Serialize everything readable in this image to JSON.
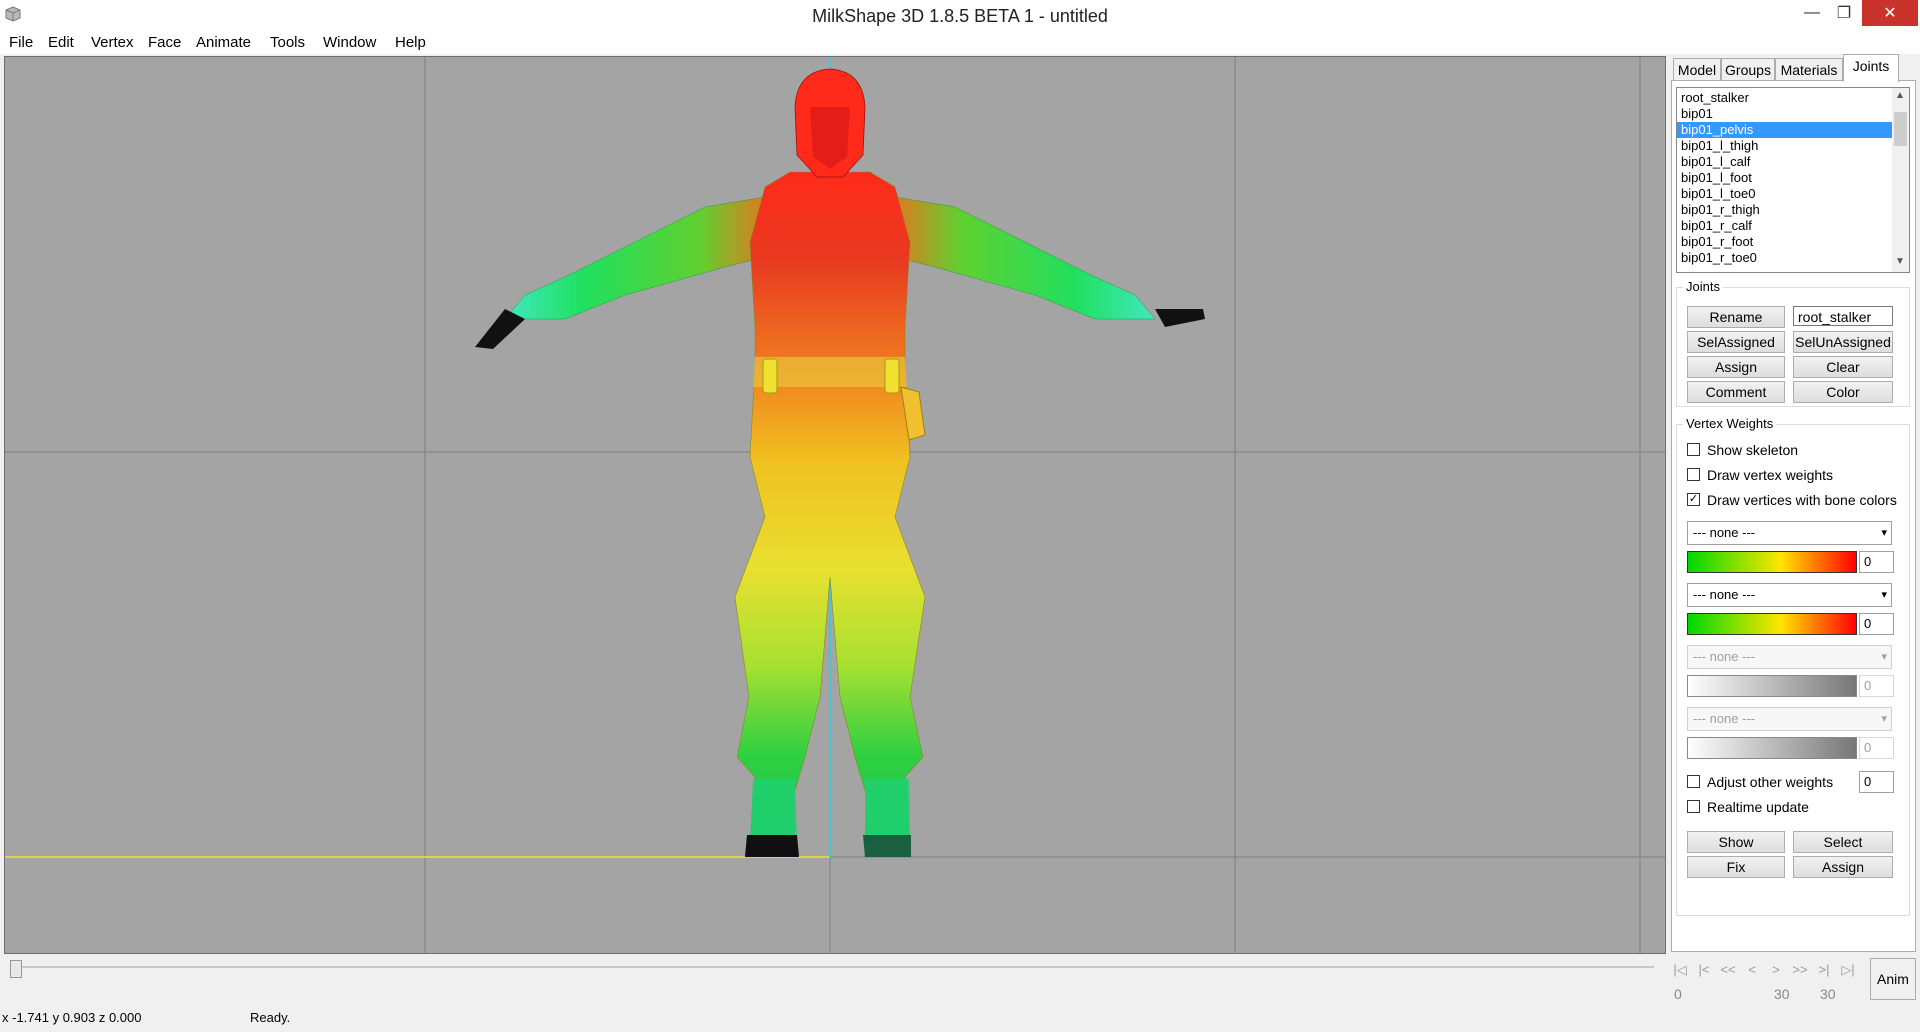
{
  "window": {
    "title": "MilkShape 3D 1.8.5 BETA 1 - untitled",
    "minimize": "—",
    "maximize": "❐",
    "close": "✕"
  },
  "menu": [
    "File",
    "Edit",
    "Vertex",
    "Face",
    "Animate",
    "Tools",
    "Window",
    "Help"
  ],
  "tabs": [
    "Model",
    "Groups",
    "Materials",
    "Joints"
  ],
  "active_tab": "Joints",
  "joint_list": [
    "root_stalker",
    "bip01",
    "bip01_pelvis",
    "bip01_l_thigh",
    "bip01_l_calf",
    "bip01_l_foot",
    "bip01_l_toe0",
    "bip01_r_thigh",
    "bip01_r_calf",
    "bip01_r_foot",
    "bip01_r_toe0"
  ],
  "selected_joint": "bip01_pelvis",
  "joints_group": {
    "label": "Joints",
    "rename": "Rename",
    "name_value": "root_stalker",
    "sel_assigned": "SelAssigned",
    "sel_unassigned": "SelUnAssigned",
    "assign": "Assign",
    "clear": "Clear",
    "comment": "Comment",
    "color": "Color"
  },
  "vertex_weights": {
    "label": "Vertex Weights",
    "show_skeleton": {
      "label": "Show skeleton",
      "checked": false
    },
    "draw_vertex_weights": {
      "label": "Draw vertex weights",
      "checked": false
    },
    "draw_bone_colors": {
      "label": "Draw vertices with bone colors",
      "checked": true
    },
    "slots": [
      {
        "bone": "--- none ---",
        "value": "0",
        "enabled": true
      },
      {
        "bone": "--- none ---",
        "value": "0",
        "enabled": true
      },
      {
        "bone": "--- none ---",
        "value": "0",
        "enabled": false
      },
      {
        "bone": "--- none ---",
        "value": "0",
        "enabled": false
      }
    ],
    "adjust_other": {
      "label": "Adjust other weights",
      "checked": false,
      "value": "0"
    },
    "realtime_update": {
      "label": "Realtime update",
      "checked": false
    },
    "show": "Show",
    "select": "Select",
    "fix": "Fix",
    "assign": "Assign"
  },
  "animation": {
    "buttons": [
      "|◁",
      "|<",
      "<<",
      "<",
      ">",
      ">>",
      ">|",
      "▷|"
    ],
    "start_frame": "0",
    "current_frame": "30",
    "end_frame": "30",
    "anim_label": "Anim",
    "timeline_position": 0
  },
  "status": {
    "coords": "x -1.741 y 0.903 z 0.000",
    "message": "Ready."
  },
  "colors": {
    "viewport_bg": "#a4a4a4",
    "selection": "#3399ff",
    "axis_x": "#e8e820",
    "axis_y": "#2ad0e0",
    "close_button": "#c8342b"
  },
  "icons": [
    "app-icon",
    "minimize-icon",
    "maximize-icon",
    "close-icon",
    "scroll-up-icon",
    "scroll-down-icon",
    "chevron-down-icon",
    "checkmark-icon"
  ]
}
